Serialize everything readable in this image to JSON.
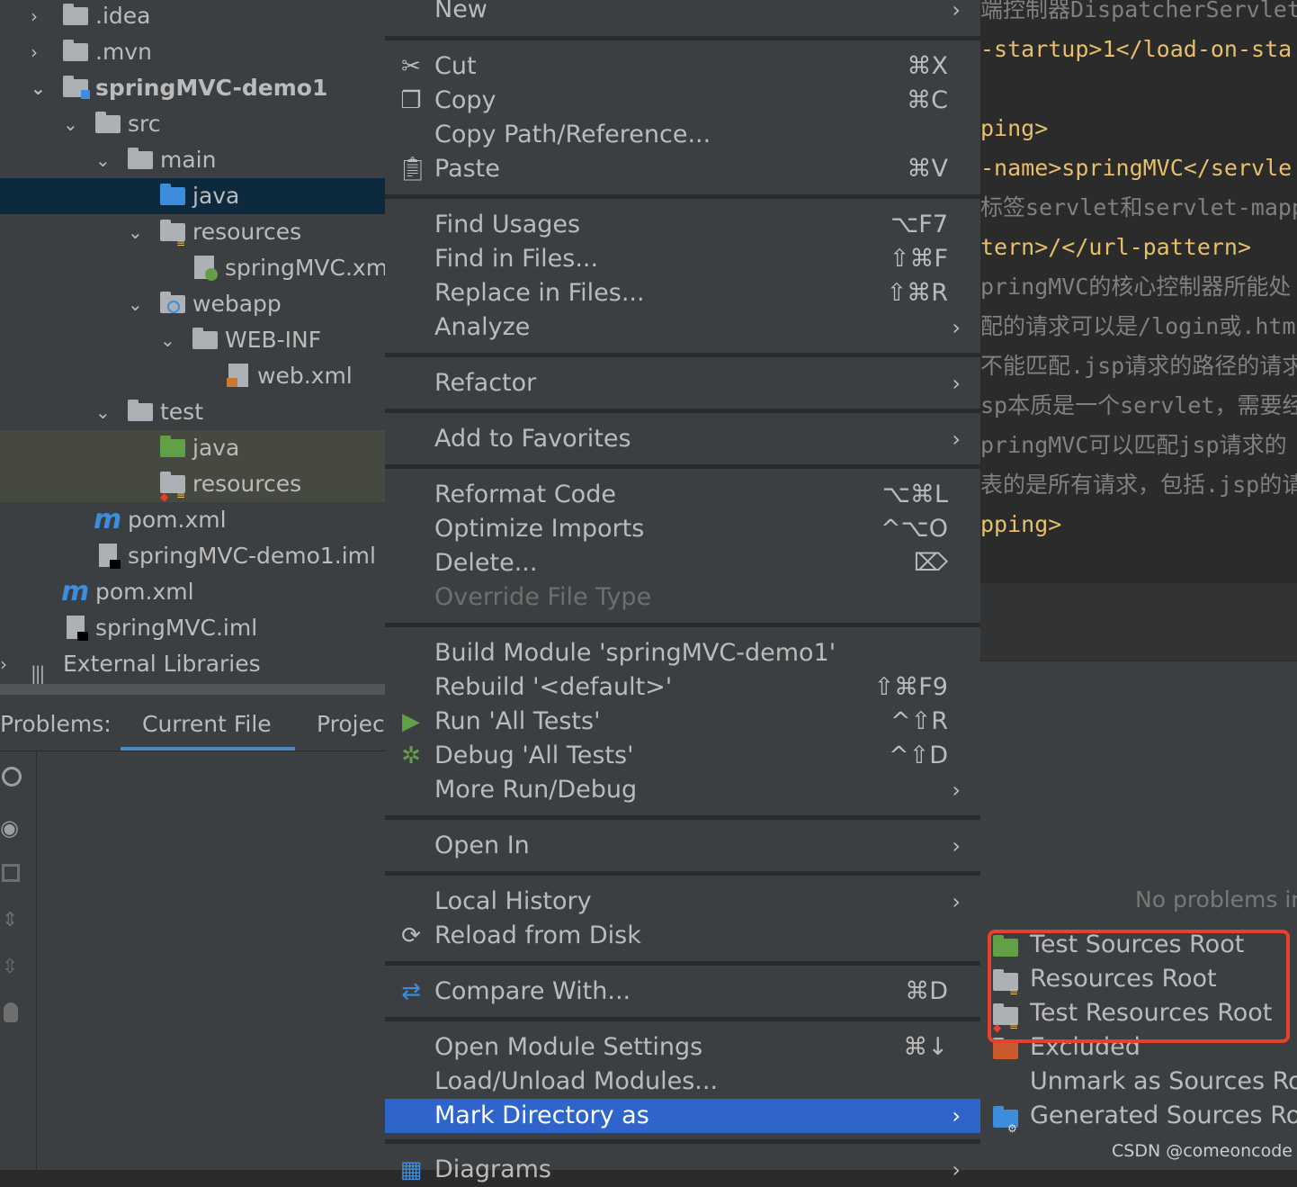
{
  "tree": {
    "items": [
      {
        "label": ".idea",
        "chevron": ">"
      },
      {
        "label": ".mvn",
        "chevron": ">"
      },
      {
        "label": "springMVC-demo1",
        "chevron": "v"
      },
      {
        "label": "src",
        "chevron": "v"
      },
      {
        "label": "main",
        "chevron": "v"
      },
      {
        "label": "java",
        "chevron": ""
      },
      {
        "label": "resources",
        "chevron": "v"
      },
      {
        "label": "springMVC.xml",
        "chevron": ""
      },
      {
        "label": "webapp",
        "chevron": "v"
      },
      {
        "label": "WEB-INF",
        "chevron": "v"
      },
      {
        "label": "web.xml",
        "chevron": ""
      },
      {
        "label": "test",
        "chevron": "v"
      },
      {
        "label": "java",
        "chevron": ""
      },
      {
        "label": "resources",
        "chevron": ""
      },
      {
        "label": "pom.xml",
        "chevron": ""
      },
      {
        "label": "springMVC-demo1.iml",
        "chevron": ""
      },
      {
        "label": "pom.xml",
        "chevron": ""
      },
      {
        "label": "springMVC.iml",
        "chevron": ""
      },
      {
        "label": "External Libraries",
        "chevron": ">"
      }
    ]
  },
  "problems": {
    "label": "Problems:",
    "tabs": [
      "Current File",
      "Projec"
    ],
    "empty_text": "No problems in"
  },
  "editor": {
    "lines": [
      "端控制器DispatcherServlet",
      "-startup>1</load-on-sta",
      "",
      "ping>",
      "-name>springMVC</servle",
      "标签servlet和servlet-mapp",
      "tern>/</url-pattern>",
      "pringMVC的核心控制器所能处",
      "配的请求可以是/login或.htm",
      "不能匹配.jsp请求的路径的请求",
      "sp本质是一个servlet，需要经",
      "pringMVC可以匹配jsp请求的",
      "表的是所有请求，包括.jsp的请",
      "pping>"
    ]
  },
  "menu": {
    "new": "New",
    "cut": "Cut",
    "cut_sc": "⌘X",
    "copy": "Copy",
    "copy_sc": "⌘C",
    "copy_path": "Copy Path/Reference...",
    "paste": "Paste",
    "paste_sc": "⌘V",
    "find_usages": "Find Usages",
    "find_usages_sc": "⌥F7",
    "find_in_files": "Find in Files...",
    "find_in_files_sc": "⇧⌘F",
    "replace_in_files": "Replace in Files...",
    "replace_in_files_sc": "⇧⌘R",
    "analyze": "Analyze",
    "refactor": "Refactor",
    "add_to_favorites": "Add to Favorites",
    "reformat_code": "Reformat Code",
    "reformat_code_sc": "⌥⌘L",
    "optimize_imports": "Optimize Imports",
    "optimize_imports_sc": "^⌥O",
    "delete": "Delete...",
    "delete_sc": "⌦",
    "override_file_type": "Override File Type",
    "build_module": "Build Module 'springMVC-demo1'",
    "rebuild": "Rebuild '<default>'",
    "rebuild_sc": "⇧⌘F9",
    "run_all_tests": "Run 'All Tests'",
    "run_all_tests_sc": "^⇧R",
    "debug_all_tests": "Debug 'All Tests'",
    "debug_all_tests_sc": "^⇧D",
    "more_run_debug": "More Run/Debug",
    "open_in": "Open In",
    "local_history": "Local History",
    "reload_from_disk": "Reload from Disk",
    "compare_with": "Compare With...",
    "compare_with_sc": "⌘D",
    "open_module_settings": "Open Module Settings",
    "open_module_settings_sc": "⌘↓",
    "load_unload_modules": "Load/Unload Modules...",
    "mark_directory_as": "Mark Directory as",
    "diagrams": "Diagrams"
  },
  "submenu": {
    "test_sources_root": "Test Sources Root",
    "resources_root": "Resources Root",
    "test_resources_root": "Test Resources Root",
    "excluded": "Excluded",
    "unmark_as_sources_root": "Unmark as Sources Ro",
    "generated_sources_root": "Generated Sources Ro"
  },
  "watermark": "CSDN @comeoncode",
  "colors": {
    "menu_bg": "#3c3f41",
    "menu_selected": "#2f65ca",
    "highlight_border": "#e8402a",
    "code_tag": "#e8bf6a",
    "code_text": "#a9b7c6",
    "code_comment": "#808080"
  }
}
